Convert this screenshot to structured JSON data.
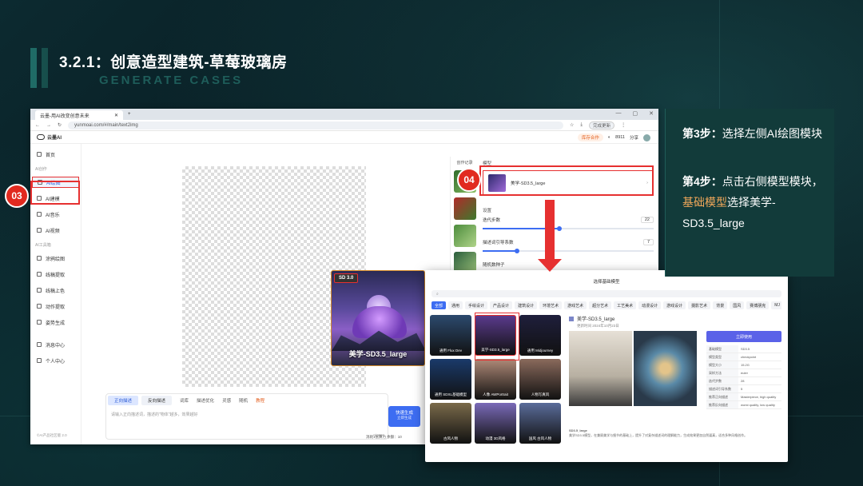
{
  "slide": {
    "title": "3.2.1：创意造型建筑-草莓玻璃房",
    "subtitle": "GENERATE CASES"
  },
  "browser": {
    "tab_title": "云墨-用AI改变创意未来",
    "url": "yunmoai.com/#/main/text2img",
    "update_button": "完成更新"
  },
  "app": {
    "logo": "云墨AI",
    "vip_label": "库存合作",
    "points": "8911",
    "share": "分享"
  },
  "sidebar": {
    "home": "首页",
    "section_create": "AI创作",
    "items": [
      {
        "label": "AI绘图",
        "active": true
      },
      {
        "label": "AI建模"
      },
      {
        "label": "AI音乐"
      },
      {
        "label": "AI视频"
      }
    ],
    "section_tools": "AI工具箱",
    "tools": [
      "涂鸦绘图",
      "线稿提取",
      "线稿上色",
      "动作提取",
      "姿势生成"
    ],
    "messages": "消息中心",
    "profile": "个人中心",
    "footer": "©AI产品社区版 2.0"
  },
  "prompt": {
    "tabs": [
      "正向描述",
      "反向描述"
    ],
    "tools": [
      "词库",
      "描述优化",
      "灵感",
      "随机",
      "教程"
    ],
    "placeholder": "请输入正向描述词，描述的\"物体\"越多，效果越好",
    "counter": "0/2000",
    "generate": "快速生成",
    "generate_sub": "立即生成",
    "credits_note": "消耗1张算力 余额：10"
  },
  "history": {
    "label": "创作记录"
  },
  "settings": {
    "model_label": "模型",
    "model_name": "美学-SD3.5_large",
    "params_label": "设置",
    "iterations_label": "迭代步数",
    "iterations_value": "22",
    "iterations_fraction": 0.45,
    "guidance_label": "描述词引导系数",
    "guidance_value": "7",
    "guidance_fraction": 0.2,
    "seed_label": "随机数种子"
  },
  "sd_card": {
    "badge": "SD 3.0",
    "name": "美学-SD3.5_large"
  },
  "modal": {
    "title": "选择基础模型",
    "categories": [
      "全部",
      "通用",
      "手绘设计",
      "产品设计",
      "建筑设计",
      "环境艺术",
      "游戏艺术",
      "超分艺术",
      "工艺美术",
      "动漫设计",
      "游戏设计",
      "摄影艺术",
      "背景",
      "国风",
      "赛博朋克",
      "MJ",
      "3D",
      "开放世界动漫风格"
    ],
    "models": [
      {
        "name": "通用 Flux Dev",
        "color": "#2c4a6e"
      },
      {
        "name": "美学-SD3.5_large",
        "color": "#5a3a8c",
        "selected": true
      },
      {
        "name": "通用 Midjourney",
        "color": "#1f1f3c"
      },
      {
        "name": "通用 SDXL基础模型",
        "color": "#1a3a6a"
      },
      {
        "name": "人像 AWPortrait",
        "color": "#b08a78"
      },
      {
        "name": "人物写真风",
        "color": "#8a6a5c"
      },
      {
        "name": "古风人物",
        "color": "#7a6a4a"
      },
      {
        "name": "动漫 3D风格",
        "color": "#7a6ab8"
      },
      {
        "name": "国风 古风人物",
        "color": "#5a6c9a"
      }
    ],
    "detail_title": "美学-SD3.5_large",
    "detail_date": "更新时间 2024年10月23日",
    "use_button": "立即使用",
    "params": [
      {
        "k": "基础模型",
        "v": "SD3.5"
      },
      {
        "k": "模型类型",
        "v": "checkpoint"
      },
      {
        "k": "模型大小",
        "v": "15.2G"
      },
      {
        "k": "采样方法",
        "v": "euler"
      },
      {
        "k": "迭代步数",
        "v": "28"
      },
      {
        "k": "描述词引导系数",
        "v": "5"
      },
      {
        "k": "推荐正向描述",
        "v": "Masterpiece, high quality"
      },
      {
        "k": "推荐反向描述",
        "v": "worst quality, low quality"
      }
    ],
    "desc_title": "SD3.5_large",
    "desc_text": "美学SD3.5模型，在兼顾美学与细节的基础上，提升了对复杂描述词的理解能力，生成效果更加自然逼真，适合多种风格创作。"
  },
  "steps": {
    "step3_prefix": "第3步：",
    "step3_text": "选择左侧AI绘图模块",
    "step4_prefix": "第4步：",
    "step4_text_a": "点击右侧模型模块，",
    "step4_highlight": "基础模型",
    "step4_text_b": "选择美学-SD3.5_large"
  },
  "callouts": {
    "c03": "03",
    "c04": "04"
  },
  "colors": {
    "accent_red": "#e63030",
    "accent_blue": "#3d6df2",
    "highlight": "#f2a85a",
    "panel": "#123b3a"
  }
}
